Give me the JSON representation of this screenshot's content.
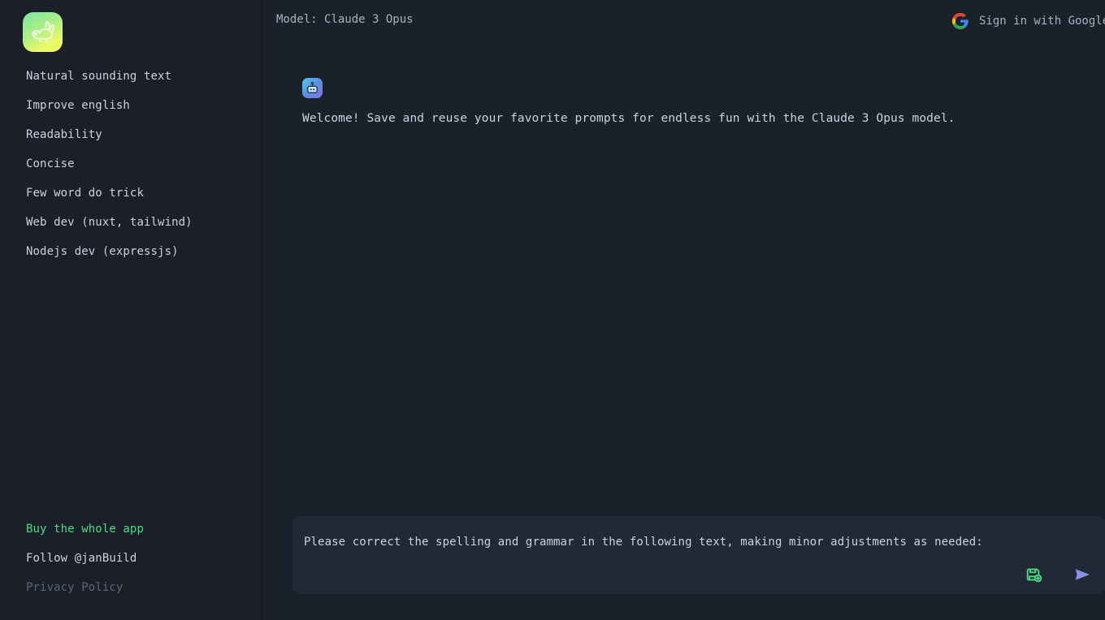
{
  "sidebar": {
    "logo": {
      "icon": "rabbit-logo-icon"
    },
    "presets": [
      {
        "label": "Natural sounding text"
      },
      {
        "label": "Improve english"
      },
      {
        "label": "Readability"
      },
      {
        "label": "Concise"
      },
      {
        "label": "Few word do trick"
      },
      {
        "label": "Web dev (nuxt, tailwind)"
      },
      {
        "label": "Nodejs dev (expressjs)"
      }
    ],
    "footer": {
      "buy": "Buy the whole app",
      "follow": "Follow @janBuild",
      "privacy": "Privacy Policy"
    }
  },
  "header": {
    "model_label": "Model: Claude 3 Opus",
    "signin_label": "Sign in with Google",
    "signin_icon": "google-icon"
  },
  "conversation": {
    "messages": [
      {
        "avatar_icon": "robot-avatar-icon",
        "text": "Welcome! Save and reuse your favorite prompts for endless fun with the Claude 3 Opus model."
      }
    ]
  },
  "composer": {
    "value": "Please correct the spelling and grammar in the following text, making minor adjustments as needed:",
    "placeholder": "Please correct the spelling and grammar in the following text, making minor adjustments as needed:",
    "save_icon": "save-prompt-icon",
    "send_icon": "send-icon"
  },
  "colors": {
    "app_background": "#1b212b",
    "sidebar_background": "#1a1f29",
    "composer_background": "#222936",
    "text_primary": "#cbd3de",
    "text_muted": "#a9b2c0",
    "text_dim": "#5c6676",
    "accent_green": "#4ade80",
    "accent_send": "#8b90e8"
  }
}
